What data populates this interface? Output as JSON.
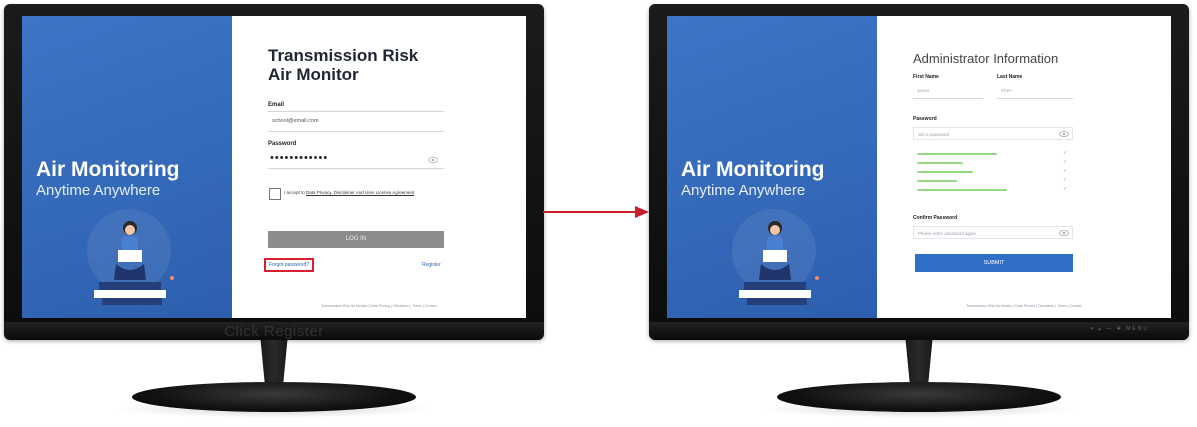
{
  "colors": {
    "brand_blue": "#3e75c6",
    "submit_blue": "#2f6fc8",
    "highlight_red": "#d92030",
    "arrow_red": "#c8202a",
    "hint_green": "#7fd36a"
  },
  "left_screen": {
    "hero": {
      "title": "Air Monitoring",
      "subtitle": "Anytime Anywhere"
    },
    "app_title_line1": "Transmission Risk",
    "app_title_line2": "Air Monitor",
    "email": {
      "label": "Email",
      "value": "school@email.com"
    },
    "password": {
      "label": "Password",
      "value": "••••••••••••"
    },
    "agree": {
      "prefix": "I accept to",
      "link": "Data Privacy, Disclaimer And User License Agreement"
    },
    "login_button": "LOG IN",
    "forgot_link": "Forgot password?",
    "register_link": "Register",
    "footer": "Transmission Risk Air Monitor | Data Privacy | Disclaimer | Terms | Contact"
  },
  "right_screen": {
    "hero": {
      "title": "Air Monitoring",
      "subtitle": "Anytime Anywhere"
    },
    "title": "Administrator Information",
    "first_name": {
      "label": "First Name",
      "placeholder": "Jason"
    },
    "last_name": {
      "label": "Last Name",
      "placeholder": "Chen"
    },
    "password": {
      "label": "Password",
      "placeholder": "Set a password"
    },
    "confirm": {
      "label": "Confirm Password",
      "placeholder": "Please enter password again"
    },
    "submit_button": "SUBMIT",
    "footer": "Transmission Risk Air Monitor | Data Privacy | Disclaimer | Terms | Contact"
  },
  "caption": "Click Register",
  "bezel_controls": "▾ ▴ — ✚ MENU"
}
